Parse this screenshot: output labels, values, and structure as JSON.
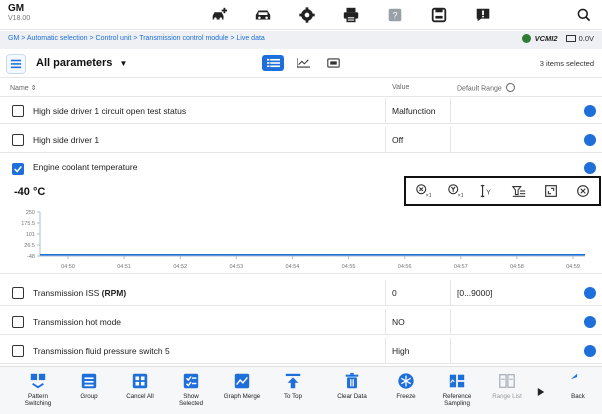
{
  "app": {
    "name": "GM",
    "version": "V18.00"
  },
  "top_icons": [
    "car-diagnose-icon",
    "car-icon",
    "gear-icon",
    "printer-icon",
    "help-icon",
    "save-icon",
    "feedback-icon"
  ],
  "breadcrumb": "GM > Automatic selection > Control unit > Transmission control module > Live data",
  "vci": {
    "label": "VCMI2",
    "voltage": "0.0V"
  },
  "param_header": {
    "title": "All parameters",
    "selected": "3 items selected"
  },
  "columns": {
    "name": "Name",
    "value": "Value",
    "range": "Default Range"
  },
  "rows_top": [
    {
      "name": "High side driver 1 circuit open test status",
      "value": "Malfunction",
      "range": ""
    },
    {
      "name": "High side driver 1",
      "value": "Off",
      "range": ""
    }
  ],
  "expanded": {
    "name": "Engine coolant temperature",
    "value": "-40 °C"
  },
  "chart_data": {
    "type": "line",
    "x": [
      "04:50",
      "04:51",
      "04:52",
      "04:53",
      "04:54",
      "04:55",
      "04:56",
      "04:57",
      "04:58",
      "04:59"
    ],
    "y_ticks": [
      "250",
      "175.5",
      "101",
      "26.5",
      "-48"
    ],
    "series": [
      {
        "values": [
          -40,
          -40,
          -40,
          -40,
          -40,
          -40,
          -40,
          -40,
          -40,
          -40
        ]
      }
    ],
    "ylim": [
      -48,
      250
    ],
    "colors": {
      "line": "#1e6fd9",
      "axis": "#b0bcd0"
    }
  },
  "rows_bottom": [
    {
      "name": "Transmission ISS",
      "unit": "(RPM)",
      "value": "0",
      "range": "[0...9000]"
    },
    {
      "name": "Transmission hot mode",
      "unit": "",
      "value": "NO",
      "range": ""
    },
    {
      "name": "Transmission fluid pressure switch 5",
      "unit": "",
      "value": "High",
      "range": ""
    }
  ],
  "toolbar": [
    {
      "label": "Pattern\nSwitching",
      "icon": "pattern-switching-icon"
    },
    {
      "label": "Group",
      "icon": "group-icon"
    },
    {
      "label": "Cancel All",
      "icon": "cancel-all-icon"
    },
    {
      "label": "Show\nSelected",
      "icon": "show-selected-icon"
    },
    {
      "label": "Graph Merge",
      "icon": "graph-merge-icon"
    },
    {
      "label": "To Top",
      "icon": "to-top-icon"
    },
    {
      "label": "Clear Data",
      "icon": "trash-icon"
    },
    {
      "label": "Freeze",
      "icon": "freeze-icon"
    },
    {
      "label": "Reference\nSampling",
      "icon": "reference-sampling-icon"
    },
    {
      "label": "Range List",
      "icon": "range-list-icon"
    },
    {
      "label": "Back",
      "icon": "back-arrow-icon"
    }
  ],
  "colors": {
    "accent": "#1e6fd9",
    "text": "#222222"
  }
}
